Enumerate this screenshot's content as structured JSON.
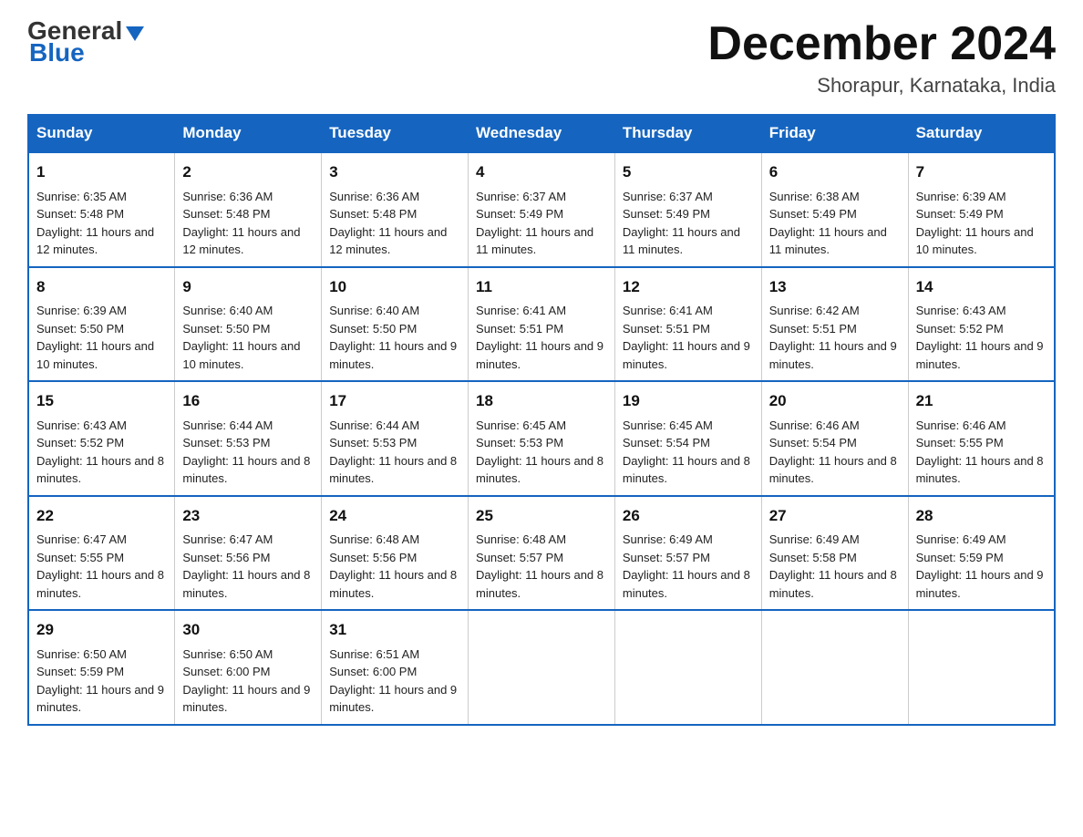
{
  "logo": {
    "line1": "General",
    "arrow": true,
    "line2": "Blue"
  },
  "title": {
    "month": "December 2024",
    "location": "Shorapur, Karnataka, India"
  },
  "days_of_week": [
    "Sunday",
    "Monday",
    "Tuesday",
    "Wednesday",
    "Thursday",
    "Friday",
    "Saturday"
  ],
  "weeks": [
    [
      {
        "day": "1",
        "sunrise": "6:35 AM",
        "sunset": "5:48 PM",
        "daylight": "11 hours and 12 minutes."
      },
      {
        "day": "2",
        "sunrise": "6:36 AM",
        "sunset": "5:48 PM",
        "daylight": "11 hours and 12 minutes."
      },
      {
        "day": "3",
        "sunrise": "6:36 AM",
        "sunset": "5:48 PM",
        "daylight": "11 hours and 12 minutes."
      },
      {
        "day": "4",
        "sunrise": "6:37 AM",
        "sunset": "5:49 PM",
        "daylight": "11 hours and 11 minutes."
      },
      {
        "day": "5",
        "sunrise": "6:37 AM",
        "sunset": "5:49 PM",
        "daylight": "11 hours and 11 minutes."
      },
      {
        "day": "6",
        "sunrise": "6:38 AM",
        "sunset": "5:49 PM",
        "daylight": "11 hours and 11 minutes."
      },
      {
        "day": "7",
        "sunrise": "6:39 AM",
        "sunset": "5:49 PM",
        "daylight": "11 hours and 10 minutes."
      }
    ],
    [
      {
        "day": "8",
        "sunrise": "6:39 AM",
        "sunset": "5:50 PM",
        "daylight": "11 hours and 10 minutes."
      },
      {
        "day": "9",
        "sunrise": "6:40 AM",
        "sunset": "5:50 PM",
        "daylight": "11 hours and 10 minutes."
      },
      {
        "day": "10",
        "sunrise": "6:40 AM",
        "sunset": "5:50 PM",
        "daylight": "11 hours and 9 minutes."
      },
      {
        "day": "11",
        "sunrise": "6:41 AM",
        "sunset": "5:51 PM",
        "daylight": "11 hours and 9 minutes."
      },
      {
        "day": "12",
        "sunrise": "6:41 AM",
        "sunset": "5:51 PM",
        "daylight": "11 hours and 9 minutes."
      },
      {
        "day": "13",
        "sunrise": "6:42 AM",
        "sunset": "5:51 PM",
        "daylight": "11 hours and 9 minutes."
      },
      {
        "day": "14",
        "sunrise": "6:43 AM",
        "sunset": "5:52 PM",
        "daylight": "11 hours and 9 minutes."
      }
    ],
    [
      {
        "day": "15",
        "sunrise": "6:43 AM",
        "sunset": "5:52 PM",
        "daylight": "11 hours and 8 minutes."
      },
      {
        "day": "16",
        "sunrise": "6:44 AM",
        "sunset": "5:53 PM",
        "daylight": "11 hours and 8 minutes."
      },
      {
        "day": "17",
        "sunrise": "6:44 AM",
        "sunset": "5:53 PM",
        "daylight": "11 hours and 8 minutes."
      },
      {
        "day": "18",
        "sunrise": "6:45 AM",
        "sunset": "5:53 PM",
        "daylight": "11 hours and 8 minutes."
      },
      {
        "day": "19",
        "sunrise": "6:45 AM",
        "sunset": "5:54 PM",
        "daylight": "11 hours and 8 minutes."
      },
      {
        "day": "20",
        "sunrise": "6:46 AM",
        "sunset": "5:54 PM",
        "daylight": "11 hours and 8 minutes."
      },
      {
        "day": "21",
        "sunrise": "6:46 AM",
        "sunset": "5:55 PM",
        "daylight": "11 hours and 8 minutes."
      }
    ],
    [
      {
        "day": "22",
        "sunrise": "6:47 AM",
        "sunset": "5:55 PM",
        "daylight": "11 hours and 8 minutes."
      },
      {
        "day": "23",
        "sunrise": "6:47 AM",
        "sunset": "5:56 PM",
        "daylight": "11 hours and 8 minutes."
      },
      {
        "day": "24",
        "sunrise": "6:48 AM",
        "sunset": "5:56 PM",
        "daylight": "11 hours and 8 minutes."
      },
      {
        "day": "25",
        "sunrise": "6:48 AM",
        "sunset": "5:57 PM",
        "daylight": "11 hours and 8 minutes."
      },
      {
        "day": "26",
        "sunrise": "6:49 AM",
        "sunset": "5:57 PM",
        "daylight": "11 hours and 8 minutes."
      },
      {
        "day": "27",
        "sunrise": "6:49 AM",
        "sunset": "5:58 PM",
        "daylight": "11 hours and 8 minutes."
      },
      {
        "day": "28",
        "sunrise": "6:49 AM",
        "sunset": "5:59 PM",
        "daylight": "11 hours and 9 minutes."
      }
    ],
    [
      {
        "day": "29",
        "sunrise": "6:50 AM",
        "sunset": "5:59 PM",
        "daylight": "11 hours and 9 minutes."
      },
      {
        "day": "30",
        "sunrise": "6:50 AM",
        "sunset": "6:00 PM",
        "daylight": "11 hours and 9 minutes."
      },
      {
        "day": "31",
        "sunrise": "6:51 AM",
        "sunset": "6:00 PM",
        "daylight": "11 hours and 9 minutes."
      },
      null,
      null,
      null,
      null
    ]
  ]
}
